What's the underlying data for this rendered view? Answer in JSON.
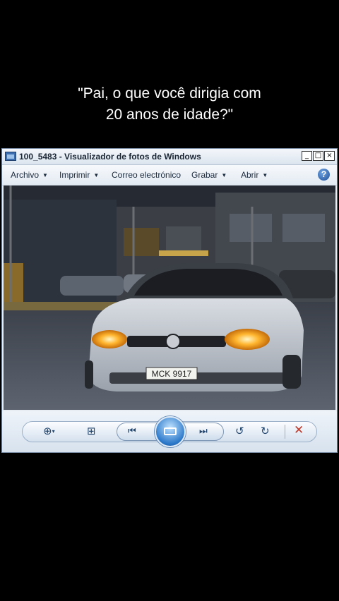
{
  "caption": {
    "line1": "\"Pai, o que você dirigia com",
    "line2": "20 anos de idade?\""
  },
  "window": {
    "title": "100_5483 - Visualizador de fotos de Windows",
    "buttons": {
      "minimize": "_",
      "maximize": "□",
      "close": "×"
    }
  },
  "menu": {
    "items": [
      {
        "label": "Archivo",
        "has_dropdown": true
      },
      {
        "label": "Imprimir",
        "has_dropdown": true
      },
      {
        "label": "Correo electrónico",
        "has_dropdown": false
      },
      {
        "label": "Grabar",
        "has_dropdown": true
      },
      {
        "label": "Abrir",
        "has_dropdown": true
      }
    ],
    "help": "?"
  },
  "photo": {
    "plate": "MCK 9917"
  },
  "controls": {
    "zoom": "zoom-icon",
    "fit": "fit-window-icon",
    "previous": "previous-icon",
    "slideshow": "slideshow-icon",
    "next": "next-icon",
    "rotate_left": "rotate-ccw-icon",
    "rotate_right": "rotate-cw-icon",
    "delete": "delete-icon",
    "delete_color": "#c0392b",
    "accent_color": "#2b78c9"
  }
}
